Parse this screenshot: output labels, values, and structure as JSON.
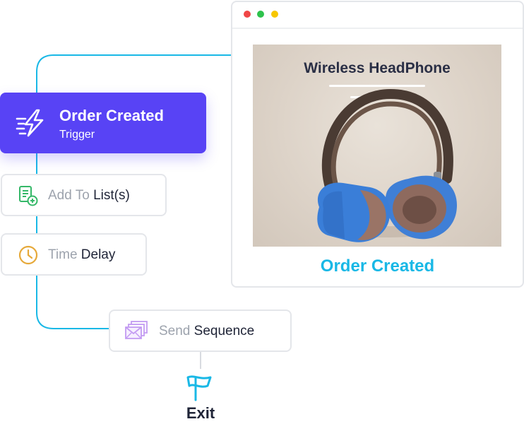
{
  "trigger": {
    "title": "Order Created",
    "subtitle": "Trigger",
    "icon": "lightning-bolt-icon",
    "color": "#5843f5"
  },
  "steps": [
    {
      "muted": "Add To ",
      "strong": "List(s)",
      "icon": "list-add-icon",
      "icon_color": "#35b868"
    },
    {
      "muted": "Time ",
      "strong": "Delay",
      "icon": "clock-icon",
      "icon_color": "#e6a93a"
    },
    {
      "muted": "Send ",
      "strong": "Sequence",
      "icon": "envelopes-icon",
      "icon_color": "#c39bf2"
    }
  ],
  "browser": {
    "window_dots": [
      "#f04646",
      "#2ec24c",
      "#f7c700"
    ],
    "product_title": "Wireless HeadPhone",
    "caption": "Order Created",
    "caption_color": "#19b8e6"
  },
  "exit": {
    "label": "Exit",
    "icon": "flag-icon",
    "icon_color": "#19b8e6"
  },
  "colors": {
    "connector": "#19b8e6",
    "card_border": "#e4e6ea",
    "muted_text": "#9da3ad",
    "strong_text": "#1f2437"
  }
}
